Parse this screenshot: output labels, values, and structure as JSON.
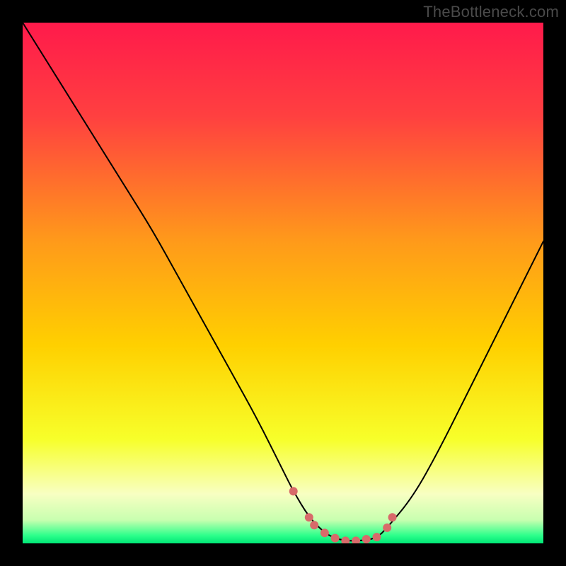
{
  "watermark": "TheBottleneck.com",
  "chart_data": {
    "type": "line",
    "title": "",
    "xlabel": "",
    "ylabel": "",
    "xlim": [
      0,
      100
    ],
    "ylim": [
      0,
      100
    ],
    "gradient_stops": [
      {
        "offset": 0.0,
        "color": "#ff1a4b"
      },
      {
        "offset": 0.18,
        "color": "#ff4040"
      },
      {
        "offset": 0.42,
        "color": "#ff9a1a"
      },
      {
        "offset": 0.62,
        "color": "#ffd000"
      },
      {
        "offset": 0.8,
        "color": "#f7ff2a"
      },
      {
        "offset": 0.905,
        "color": "#f8ffc2"
      },
      {
        "offset": 0.955,
        "color": "#c8ffb0"
      },
      {
        "offset": 0.985,
        "color": "#2cff8b"
      },
      {
        "offset": 1.0,
        "color": "#00e676"
      }
    ],
    "series": [
      {
        "name": "bottleneck-curve",
        "x": [
          0,
          5,
          10,
          15,
          20,
          25,
          30,
          35,
          40,
          45,
          50,
          52,
          55,
          58,
          60,
          62,
          65,
          68,
          70,
          75,
          80,
          85,
          90,
          95,
          100
        ],
        "y": [
          100,
          92,
          84,
          76,
          68,
          60,
          51,
          42,
          33,
          24,
          14,
          10,
          5,
          2,
          1,
          0.5,
          0.5,
          1,
          3,
          9,
          18,
          28,
          38,
          48,
          58
        ]
      }
    ],
    "markers": {
      "name": "flat-region",
      "color": "#d86a6a",
      "radius_px": 6,
      "x": [
        52,
        55,
        56,
        58,
        60,
        62,
        64,
        66,
        68,
        70,
        71
      ],
      "y": [
        10,
        5,
        3.5,
        2,
        1,
        0.5,
        0.5,
        0.8,
        1.2,
        3,
        5
      ]
    }
  }
}
